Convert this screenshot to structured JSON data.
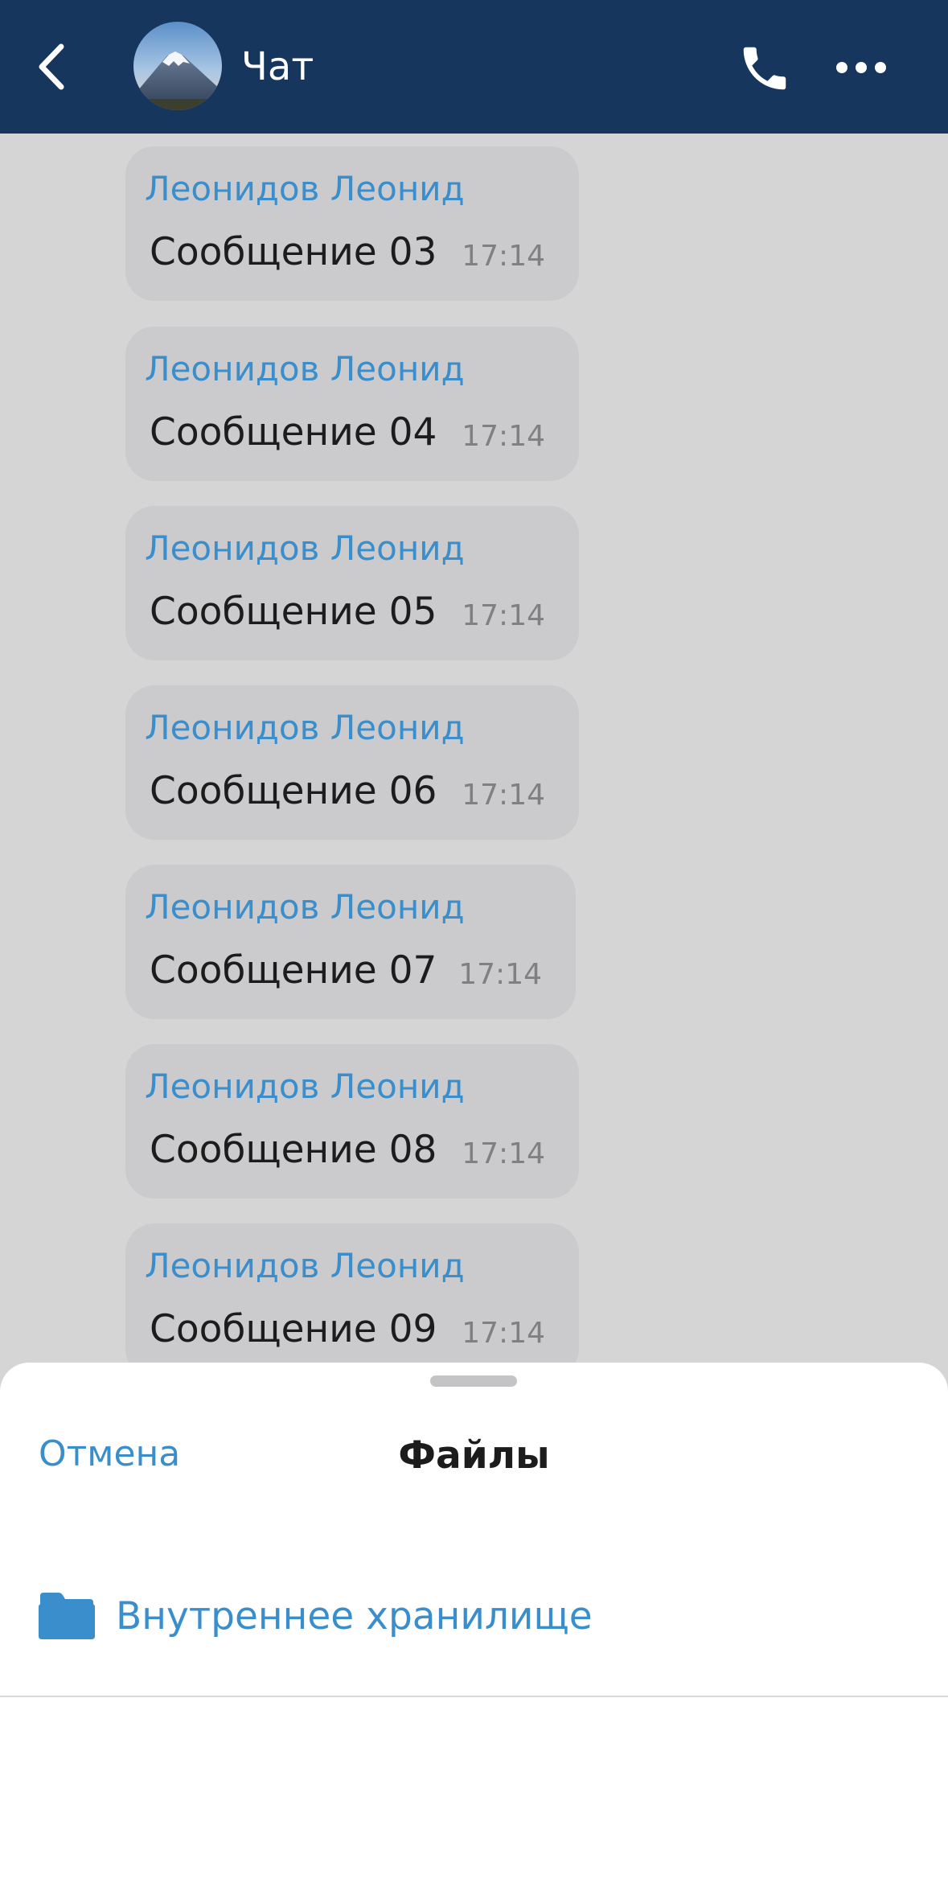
{
  "header": {
    "title": "Чат",
    "back_icon": "chevron-left-icon",
    "call_icon": "phone-icon",
    "more_icon": "more-horizontal-icon"
  },
  "messages": [
    {
      "sender": "Леонидов Леонид",
      "text": "Сообщение 03",
      "time": "17:14"
    },
    {
      "sender": "Леонидов Леонид",
      "text": "Сообщение 04",
      "time": "17:14"
    },
    {
      "sender": "Леонидов Леонид",
      "text": "Сообщение 05",
      "time": "17:14"
    },
    {
      "sender": "Леонидов Леонид",
      "text": "Сообщение 06",
      "time": "17:14"
    },
    {
      "sender": "Леонидов Леонид",
      "text": "Сообщение 07",
      "time": "17:14"
    },
    {
      "sender": "Леонидов Леонид",
      "text": "Сообщение 08",
      "time": "17:14"
    },
    {
      "sender": "Леонидов Леонид",
      "text": "Сообщение 09",
      "time": "17:14"
    }
  ],
  "sheet": {
    "cancel_label": "Отмена",
    "title": "Файлы",
    "items": [
      {
        "label": "Внутреннее хранилище",
        "icon": "folder-icon"
      }
    ]
  },
  "colors": {
    "header_bg": "#17365d",
    "accent": "#3a8ecb",
    "chat_bg": "#d5d5d5",
    "bubble_bg": "#cbcbcd"
  }
}
